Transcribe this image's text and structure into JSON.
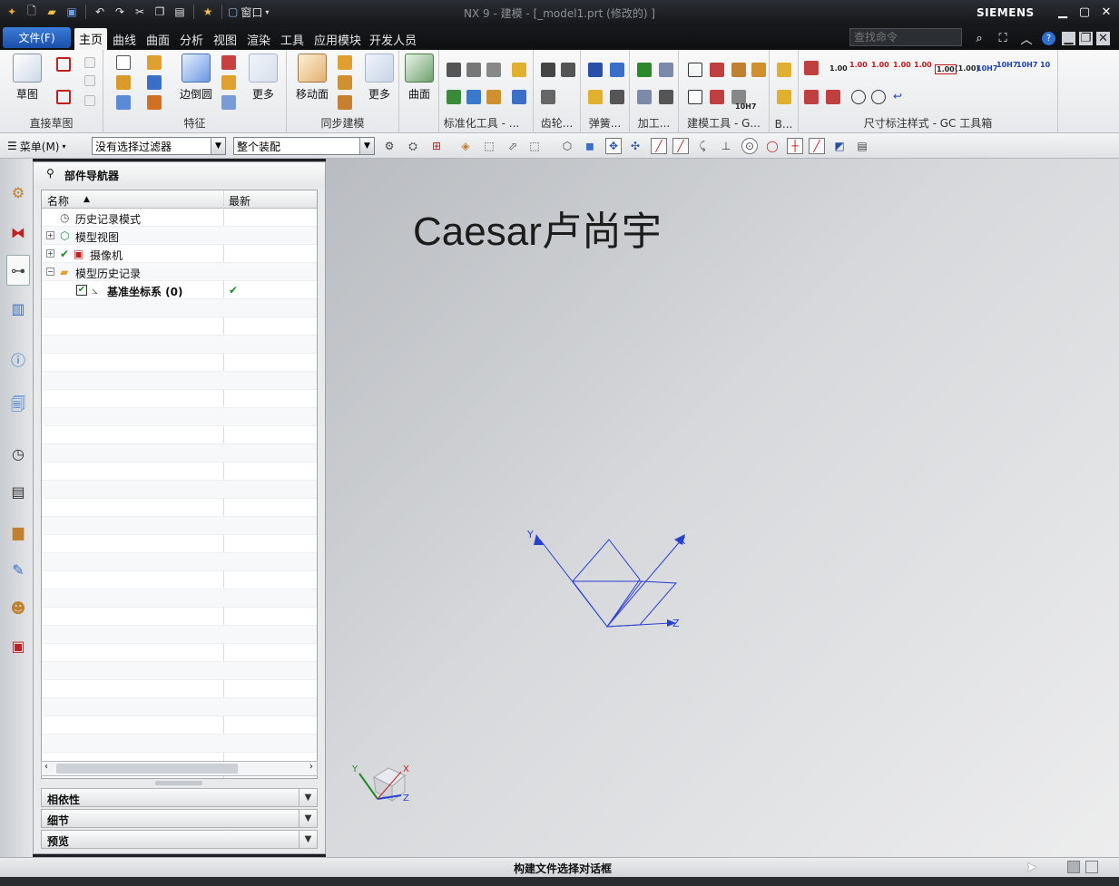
{
  "window": {
    "title": "NX 9 - 建模 - [_model1.prt  (修改的) ]",
    "brand": "SIEMENS",
    "window_menu": "窗口"
  },
  "tabs": {
    "file": "文件(F)",
    "items": [
      "主页",
      "曲线",
      "曲面",
      "分析",
      "视图",
      "渲染",
      "工具",
      "应用模块",
      "开发人员"
    ],
    "active": "主页"
  },
  "search": {
    "placeholder": "查找命令"
  },
  "ribbon": {
    "groups": [
      "直接草图",
      "特征",
      "同步建模",
      "标准化工具 - ...",
      "齿轮...",
      "弹簧...",
      "加工...",
      "建模工具 - G...",
      "B...",
      "尺寸标注样式 - GC 工具箱"
    ],
    "buttons": {
      "sketch": "草图",
      "edge_blend": "边倒圆",
      "more1": "更多",
      "move_face": "移动面",
      "more2": "更多",
      "surface": "曲面"
    },
    "dim_labels": [
      "1.00",
      "1.00",
      "1.00",
      "1.00",
      "1.00",
      "(1.00)",
      "10H7",
      "10H7",
      "10H7",
      "10"
    ],
    "tool_label": "10H7"
  },
  "selection_bar": {
    "menu": "菜单(M)",
    "filter": "没有选择过滤器",
    "scope": "整个装配"
  },
  "navigator": {
    "title": "部件导航器",
    "columns": [
      "名称",
      "最新"
    ],
    "nodes": [
      {
        "label": "历史记录模式",
        "bold": false
      },
      {
        "label": "模型视图",
        "bold": false
      },
      {
        "label": "摄像机",
        "bold": false
      },
      {
        "label": "模型历史记录",
        "bold": false
      },
      {
        "label": "基准坐标系 (0)",
        "bold": true,
        "latest": "✔"
      }
    ],
    "panels": [
      "相依性",
      "细节",
      "预览"
    ]
  },
  "viewport": {
    "watermark": "Caesar卢尚宇",
    "axes": [
      "X",
      "Y",
      "Z"
    ]
  },
  "status": {
    "text": "构建文件选择对话框"
  },
  "colors": {
    "accent": "#1a4fa8",
    "csys": "#2a3fd0",
    "check": "#1e8a2a"
  }
}
